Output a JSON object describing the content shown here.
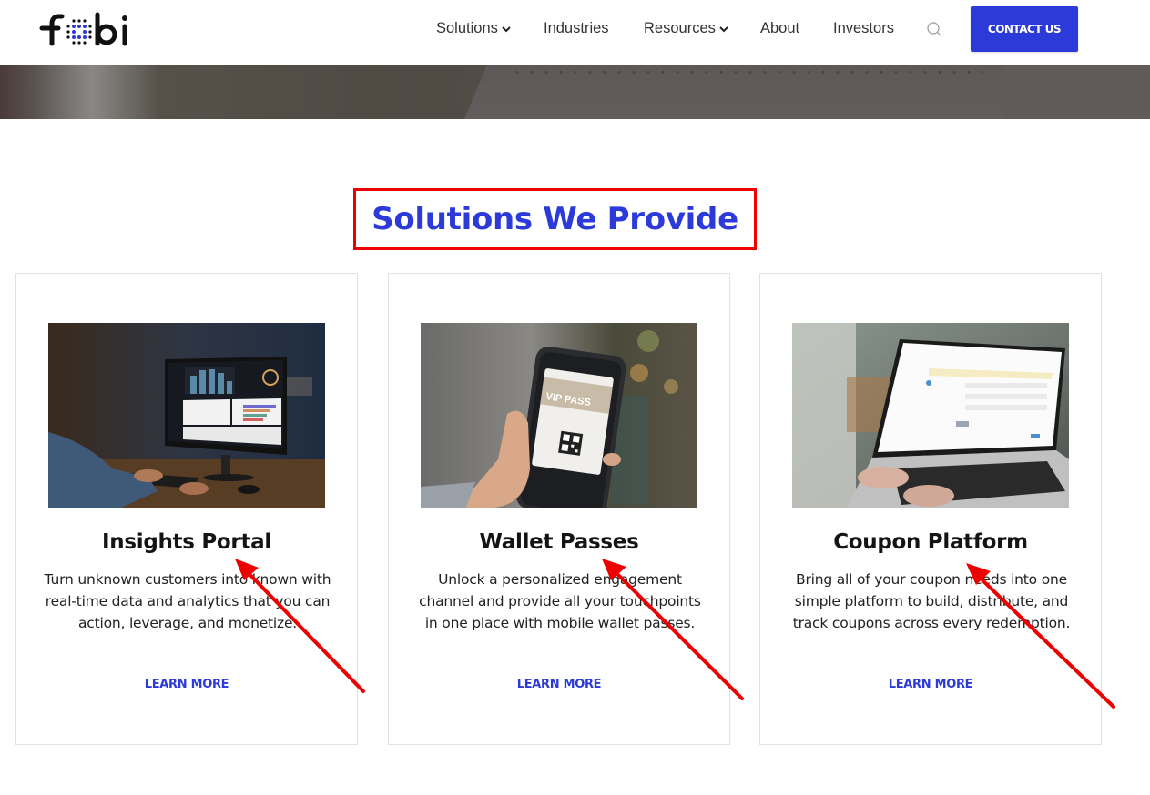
{
  "brand": {
    "logo_text": "fobi",
    "accent_color": "#2b3ad8",
    "annotation_color": "#ee0000"
  },
  "nav": {
    "items": [
      {
        "label": "Solutions",
        "has_dropdown": true
      },
      {
        "label": "Industries",
        "has_dropdown": false
      },
      {
        "label": "Resources",
        "has_dropdown": true
      },
      {
        "label": "About",
        "has_dropdown": false
      },
      {
        "label": "Investors",
        "has_dropdown": false
      }
    ],
    "search_icon": "search-icon",
    "contact_label": "CONTACT US"
  },
  "section": {
    "title": "Solutions We Provide"
  },
  "cards": [
    {
      "title": "Insights Portal",
      "description": "Turn unknown customers into known with real-time data and analytics that you can action, leverage, and monetize.",
      "link_label": "LEARN MORE",
      "image": "analytics-dashboard-monitor-photo"
    },
    {
      "title": "Wallet Passes",
      "description": "Unlock a personalized engagement channel and provide all your touchpoints in one place with mobile wallet passes.",
      "link_label": "LEARN MORE",
      "image": "phone-vip-pass-photo",
      "image_text": "VIP PASS"
    },
    {
      "title": "Coupon Platform",
      "description": "Bring all of your coupon needs into one simple platform to build, distribute, and track coupons across every redemption.",
      "link_label": "LEARN MORE",
      "image": "laptop-create-campaign-photo"
    }
  ]
}
